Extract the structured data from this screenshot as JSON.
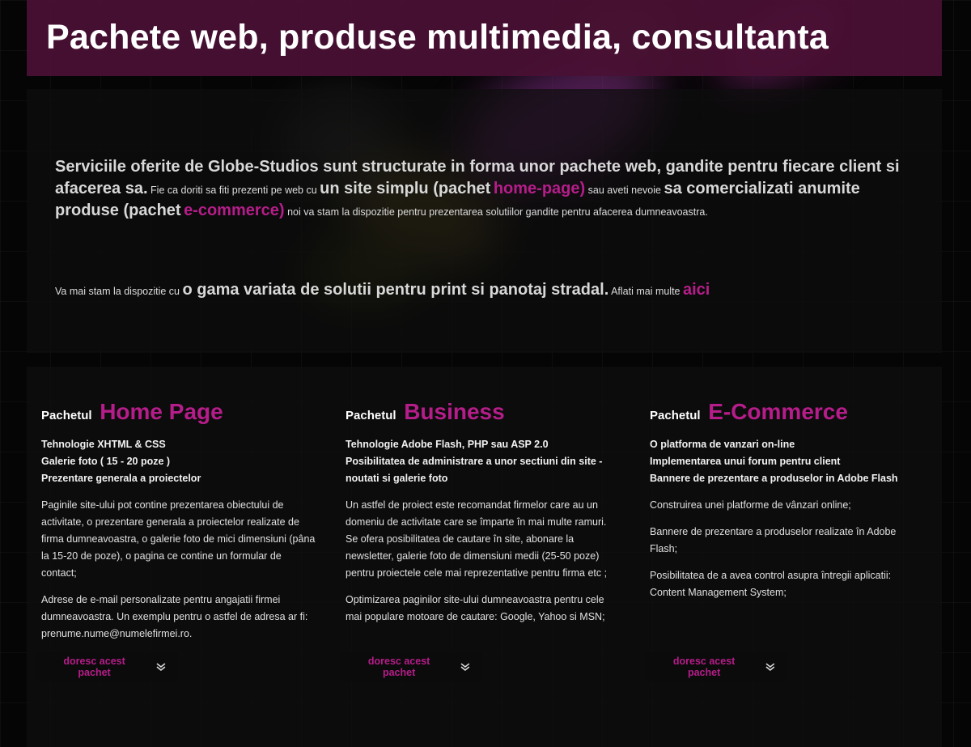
{
  "header": {
    "title": "Pachete web, produse multimedia, consultanta"
  },
  "colors": {
    "accent": "#b61d8a",
    "header_bg": "#4a1034",
    "background": "#050505"
  },
  "intro": {
    "p1_bold1": "Serviciile oferite de Globe-Studios sunt structurate in forma unor pachete web, gandite pentru fiecare client si afacerea sa.",
    "p1_small1": "Fie ca doriti sa fiti prezenti pe web cu",
    "p1_bold2": "un site simplu (pachet",
    "p1_link1": "home-page)",
    "p1_small2": "sau aveti nevoie",
    "p1_bold3": "sa comercializati anumite produse (pachet",
    "p1_link2": "e-commerce)",
    "p1_small3": "noi va stam la dispozitie pentru prezentarea solutiilor gandite pentru afacerea dumneavoastra.",
    "p2_small1": "Va mai stam la dispozitie cu",
    "p2_bold": "o gama variata de solutii pentru print si panotaj stradal.",
    "p2_small2": "Aflati mai multe",
    "p2_link": "aici"
  },
  "packages": [
    {
      "prefix": "Pachetul",
      "name": "Home Page",
      "features": [
        "Tehnologie XHTML & CSS",
        "Galerie foto ( 15 - 20 poze )",
        "Prezentare generala a proiectelor"
      ],
      "paragraphs": [
        "Paginile site-ului pot contine prezentarea obiectului de activitate, o prezentare generala a proiectelor realizate de firma dumneavoastra, o galerie foto de mici dimensiuni (pâna la 15-20 de poze), o pagina ce contine un formular de contact;",
        "Adrese de e-mail personalizate pentru angajatii firmei dumneavoastra. Un exemplu pentru o astfel de adresa ar fi: prenume.nume@numelefirmei.ro."
      ],
      "button": "doresc acest pachet"
    },
    {
      "prefix": "Pachetul",
      "name": "Business",
      "features": [
        "Tehnologie Adobe Flash, PHP sau ASP 2.0",
        "Posibilitatea de administrare a unor sectiuni din site - noutati si galerie foto"
      ],
      "paragraphs": [
        "Un astfel de proiect este recomandat firmelor care au un domeniu de activitate care se împarte în mai multe ramuri. Se ofera posibilitatea de cautare în site, abonare la newsletter, galerie foto de dimensiuni medii (25-50 poze) pentru proiectele cele mai reprezentative pentru firma etc ;",
        "Optimizarea paginilor site-ului dumneavoastra pentru cele mai populare motoare de cautare: Google, Yahoo si MSN;"
      ],
      "button": "doresc acest pachet"
    },
    {
      "prefix": "Pachetul",
      "name": "E-Commerce",
      "features": [
        "O platforma de vanzari on-line",
        "Implementarea unui forum pentru client",
        "Bannere de prezentare a produselor in Adobe Flash"
      ],
      "paragraphs": [
        "Construirea unei platforme de vânzari online;",
        "Bannere de prezentare a produselor realizate în Adobe Flash;",
        "Posibilitatea de a avea control asupra întregii aplicatii: Content Management System;"
      ],
      "button": "doresc acest pachet"
    }
  ]
}
